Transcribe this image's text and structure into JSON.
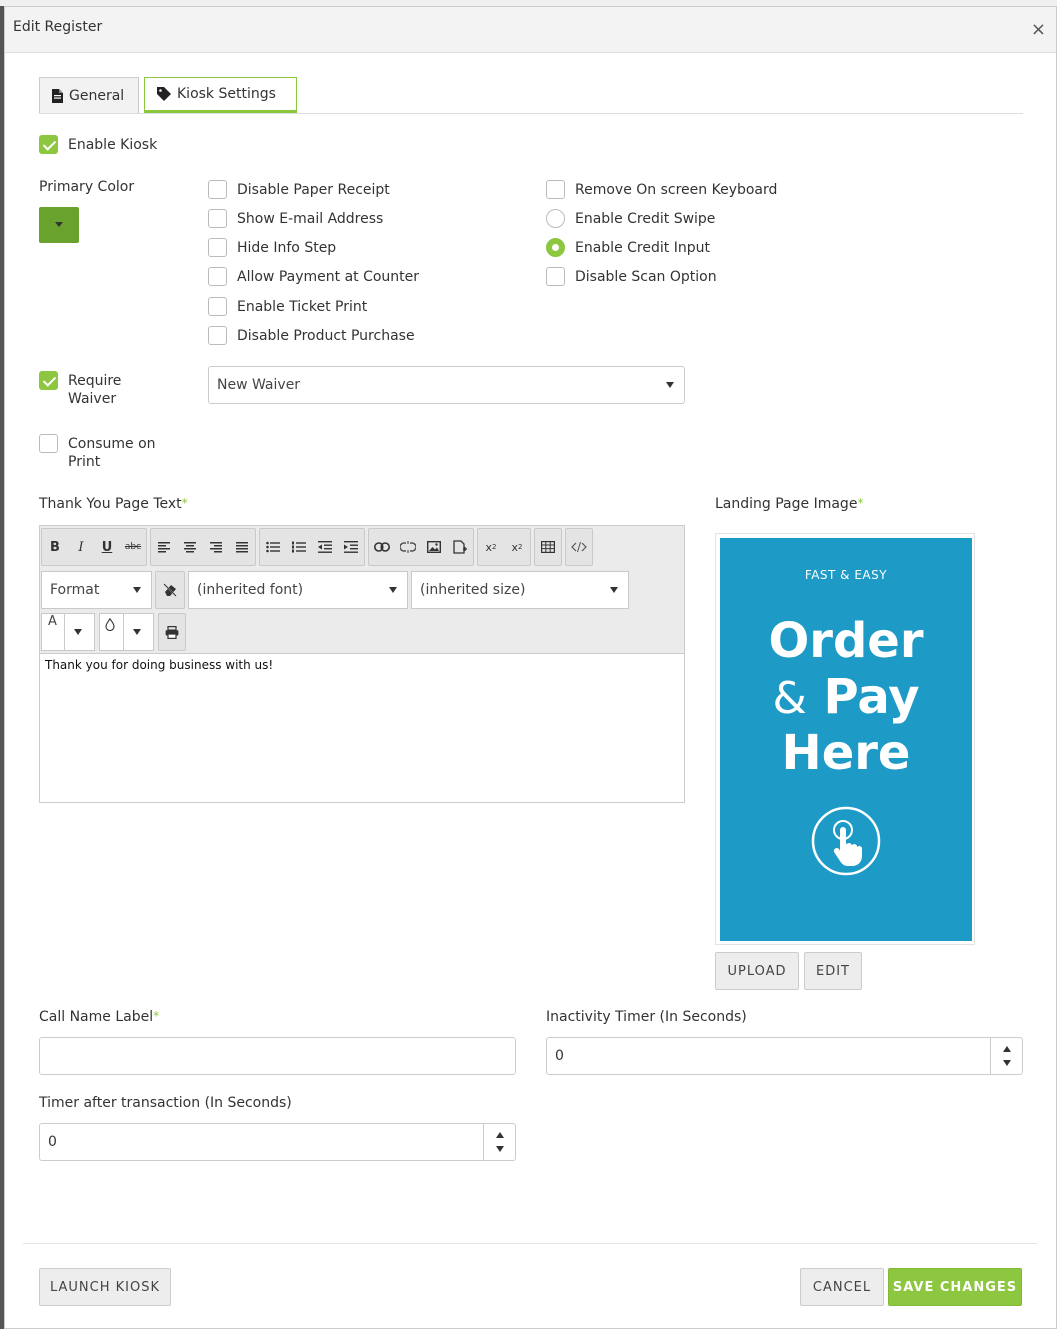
{
  "modal": {
    "title": "Edit Register",
    "close": "×"
  },
  "tabs": [
    {
      "label": "General"
    },
    {
      "label": "Kiosk Settings"
    }
  ],
  "enable_kiosk": {
    "label": "Enable Kiosk",
    "checked": true
  },
  "primary_color": {
    "label": "Primary Color",
    "value": "#6aa22e"
  },
  "options_left": [
    {
      "label": "Disable Paper Receipt",
      "checked": false
    },
    {
      "label": "Show E-mail Address",
      "checked": false
    },
    {
      "label": "Hide Info Step",
      "checked": false
    },
    {
      "label": "Allow Payment at Counter",
      "checked": false
    },
    {
      "label": "Enable Ticket Print",
      "checked": false
    },
    {
      "label": "Disable Product Purchase",
      "checked": false
    }
  ],
  "options_right": [
    {
      "label": "Remove On screen Keyboard",
      "type": "checkbox",
      "checked": false
    },
    {
      "label": "Enable Credit Swipe",
      "type": "radio",
      "checked": false
    },
    {
      "label": "Enable Credit Input",
      "type": "radio",
      "checked": true
    },
    {
      "label": "Disable Scan Option",
      "type": "checkbox",
      "checked": false
    }
  ],
  "require_waiver": {
    "label_line1": "Require",
    "label_line2": "Waiver",
    "checked": true,
    "select_value": "New Waiver"
  },
  "consume_on_print": {
    "label_line1": "Consume on",
    "label_line2": "Print",
    "checked": false
  },
  "thank_you": {
    "label": "Thank You Page Text",
    "required": "*",
    "toolbar": {
      "bold": "B",
      "italic": "I",
      "underline": "U",
      "strike": "abc",
      "format": "Format",
      "font": "(inherited font)",
      "size": "(inherited size)",
      "text_color": "A"
    },
    "content": "Thank you for doing business with us!"
  },
  "landing_image": {
    "label": "Landing Page Image",
    "required": "*",
    "poster": {
      "kicker": "FAST & EASY",
      "line1": "Order",
      "amp": "&",
      "line2": "Pay",
      "line3": "Here"
    },
    "upload": "UPLOAD",
    "edit": "EDIT"
  },
  "call_name": {
    "label": "Call Name Label",
    "required": "*",
    "value": ""
  },
  "inactivity": {
    "label": "Inactivity Timer (In Seconds)",
    "value": "0"
  },
  "timer_after": {
    "label": "Timer after transaction (In Seconds)",
    "value": "0"
  },
  "footer": {
    "launch": "LAUNCH KIOSK",
    "cancel": "CANCEL",
    "save": "SAVE CHANGES"
  },
  "colors": {
    "accent": "#8dc63f",
    "poster_bg": "#1e9ac6"
  }
}
